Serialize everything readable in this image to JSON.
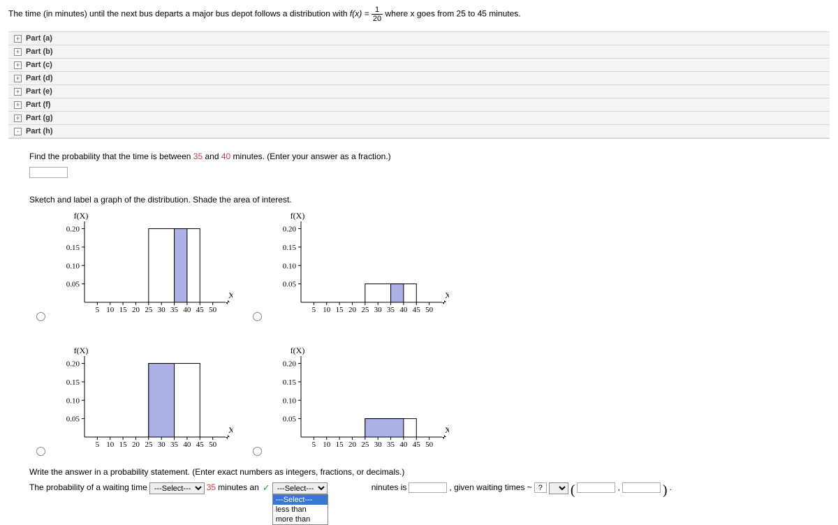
{
  "problem": {
    "prefix": "The time (in minutes) until the next bus departs a major bus depot follows a distribution with ",
    "fx": "f(x) = ",
    "frac_num": "1",
    "frac_den": "20",
    "suffix": " where x goes from 25 to 45 minutes."
  },
  "parts": [
    "Part (a)",
    "Part (b)",
    "Part (c)",
    "Part (d)",
    "Part (e)",
    "Part (f)",
    "Part (g)",
    "Part (h)"
  ],
  "question": {
    "line1_a": "Find the probability that the time is between ",
    "line1_b": "35",
    "line1_c": " and ",
    "line1_d": "40",
    "line1_e": " minutes. (Enter your answer as a fraction.)"
  },
  "sketch_instruction": "Sketch and label a graph of the distribution. Shade the area of interest.",
  "chart_data": [
    {
      "type": "bar",
      "xlabel": "X",
      "ylabel": "f(X)",
      "x_ticks": [
        5,
        10,
        15,
        20,
        25,
        30,
        35,
        40,
        45,
        50
      ],
      "y_ticks": [
        0.05,
        0.1,
        0.15,
        0.2
      ],
      "support": [
        25,
        45
      ],
      "height": 0.2,
      "shade": [
        35,
        40
      ]
    },
    {
      "type": "bar",
      "xlabel": "X",
      "ylabel": "f(X)",
      "x_ticks": [
        5,
        10,
        15,
        20,
        25,
        30,
        35,
        40,
        45,
        50
      ],
      "y_ticks": [
        0.05,
        0.1,
        0.15,
        0.2
      ],
      "support": [
        25,
        45
      ],
      "height": 0.05,
      "shade": [
        35,
        40
      ]
    },
    {
      "type": "bar",
      "xlabel": "X",
      "ylabel": "f(X)",
      "x_ticks": [
        5,
        10,
        15,
        20,
        25,
        30,
        35,
        40,
        45,
        50
      ],
      "y_ticks": [
        0.05,
        0.1,
        0.15,
        0.2
      ],
      "support": [
        25,
        45
      ],
      "height": 0.2,
      "shade": [
        25,
        35
      ]
    },
    {
      "type": "bar",
      "xlabel": "X",
      "ylabel": "f(X)",
      "x_ticks": [
        5,
        10,
        15,
        20,
        25,
        30,
        35,
        40,
        45,
        50
      ],
      "y_ticks": [
        0.05,
        0.1,
        0.15,
        0.2
      ],
      "support": [
        25,
        45
      ],
      "height": 0.05,
      "shade": [
        25,
        40
      ]
    }
  ],
  "bottom": {
    "instruction": "Write the answer in a probability statement. (Enter exact numbers as integers, fractions, or decimals.)",
    "t1": "The probability of a waiting time ",
    "select1": "---Select---",
    "t2": "35",
    "t3": " minutes an",
    "dropdown": {
      "selected": "---Select---",
      "options": [
        "---Select---",
        "less than",
        "more than"
      ]
    },
    "t4": "ninutes is ",
    "t5": ", given waiting times ~ ",
    "q": "?",
    "comma": ",",
    "period": "."
  }
}
